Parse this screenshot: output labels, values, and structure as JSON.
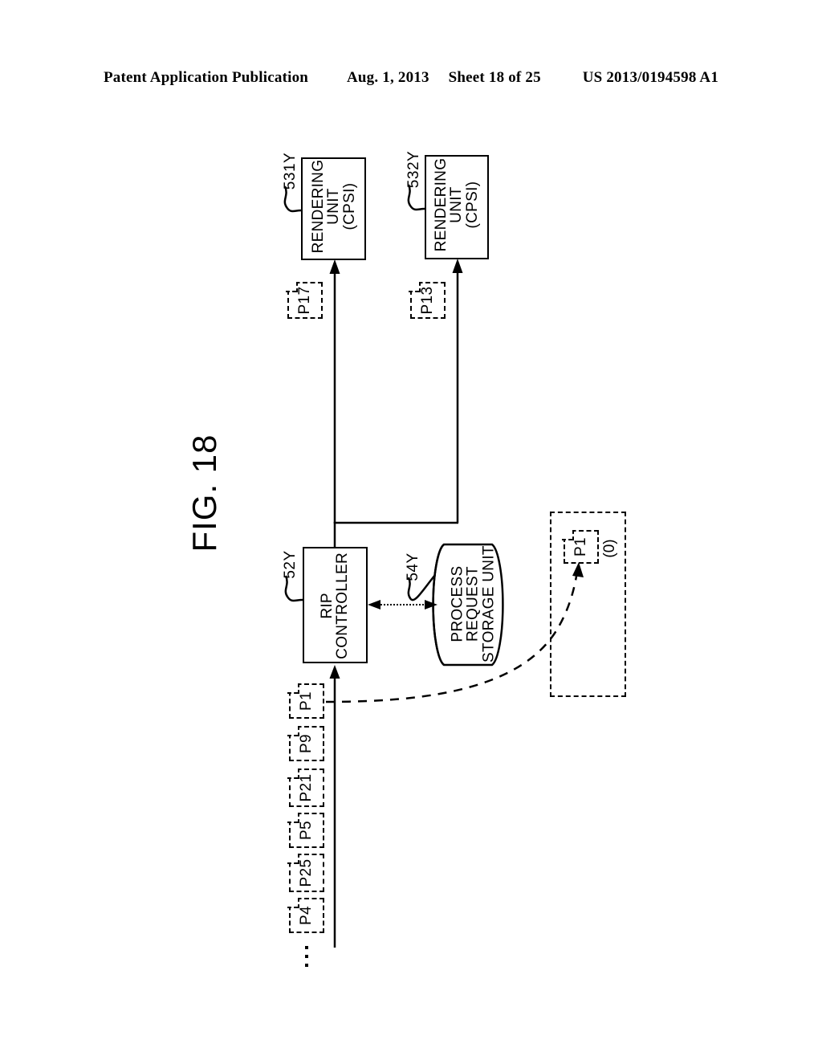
{
  "header": {
    "publication": "Patent Application Publication",
    "date": "Aug. 1, 2013",
    "sheet": "Sheet 18 of 25",
    "number": "US 2013/0194598 A1"
  },
  "figure": {
    "label": "FIG. 18"
  },
  "blocks": {
    "rendering_unit_1": {
      "ref": "531Y",
      "line1": "RENDERING",
      "line2": "UNIT",
      "line3": "(CPSI)"
    },
    "rendering_unit_2": {
      "ref": "532Y",
      "line1": "RENDERING",
      "line2": "UNIT",
      "line3": "(CPSI)"
    },
    "rip_controller": {
      "ref": "52Y",
      "line1": "RIP",
      "line2": "CONTROLLER"
    },
    "storage_unit": {
      "ref": "54Y",
      "line1": "PROCESS",
      "line2": "REQUEST",
      "line3": "STORAGE UNIT"
    }
  },
  "jobs": {
    "to_renderer_1": "P17",
    "to_renderer_2": "P13",
    "queue": [
      "P1",
      "P9",
      "P21",
      "P5",
      "P25",
      "P4"
    ],
    "stored": {
      "label": "P1",
      "count": "(0)"
    }
  }
}
